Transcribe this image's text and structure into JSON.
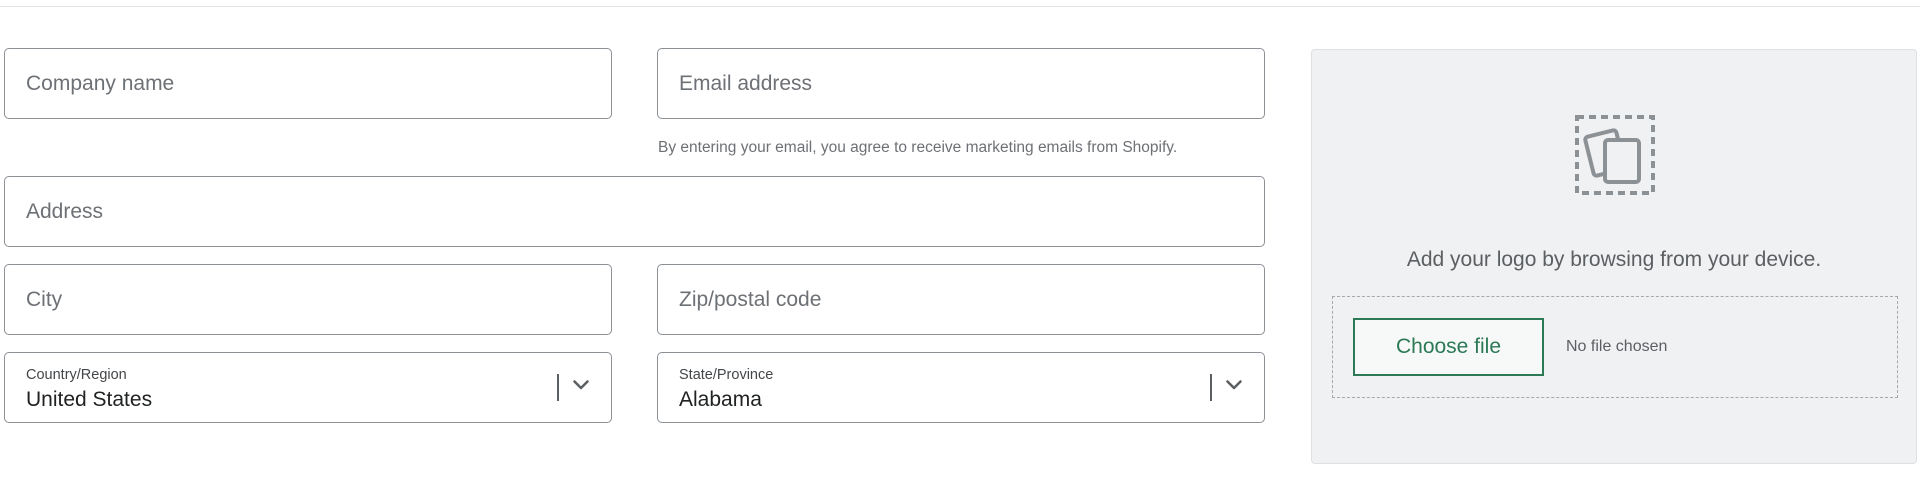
{
  "form": {
    "company": {
      "placeholder": "Company name",
      "value": ""
    },
    "email": {
      "placeholder": "Email address",
      "value": ""
    },
    "email_consent": "By entering your email, you agree to receive marketing emails from Shopify.",
    "address": {
      "placeholder": "Address",
      "value": ""
    },
    "city": {
      "placeholder": "City",
      "value": ""
    },
    "zip": {
      "placeholder": "Zip/postal code",
      "value": ""
    },
    "country": {
      "label": "Country/Region",
      "value": "United States"
    },
    "state": {
      "label": "State/Province",
      "value": "Alabama"
    }
  },
  "upload": {
    "icon": "image-placeholder-icon",
    "prompt": "Add your logo by browsing from your device.",
    "button_label": "Choose file",
    "status": "No file chosen"
  },
  "colors": {
    "accent": "#2b7a55",
    "border": "#8c9196",
    "panel_bg": "#f0f1f3"
  }
}
